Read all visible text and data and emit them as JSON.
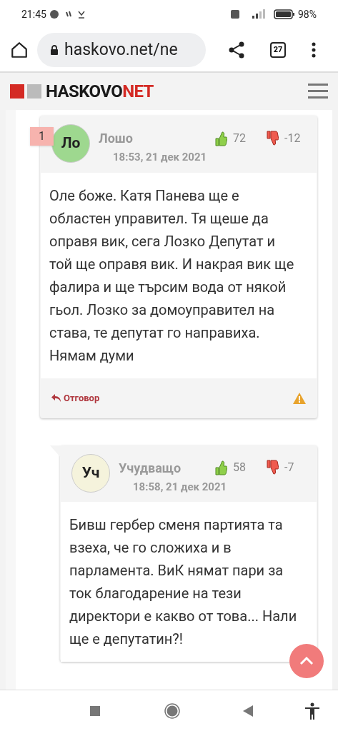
{
  "status_bar": {
    "time": "21:45",
    "battery": "98%"
  },
  "browser": {
    "url": "haskovo.net/ne",
    "tab_count": "27"
  },
  "site_header": {
    "logo_main": "HASKOVO",
    "logo_accent": "NET"
  },
  "comments": [
    {
      "rank": "1",
      "initials": "Ло",
      "color": "#9ed88f",
      "name": "Лошо",
      "time": "18:53, 21 дек 2021",
      "likes": "72",
      "dislikes": "-12",
      "text": "Оле боже. Катя Панева ще е областен управител. Тя щеше да оправя вик, сега Лозко Депутат и той ще оправя вик. И накрая вик ще фалира и ще търсим вода от някой гьол. Лозко за домоуправител на става, те депутат го направиха. Нямам думи",
      "reply": "Отговор",
      "nested": false
    },
    {
      "initials": "Уч",
      "color": "#f5f3dc",
      "name": "Учудващо",
      "time": "18:58, 21 дек 2021",
      "likes": "58",
      "dislikes": "-7",
      "text": "Бивш гербер сменя партията та взеха, че го сложиха и в парламента. ВиК нямат пари за ток благодарение на тези директори е какво от това... Нали ще е депутатин?!",
      "nested": true
    }
  ]
}
